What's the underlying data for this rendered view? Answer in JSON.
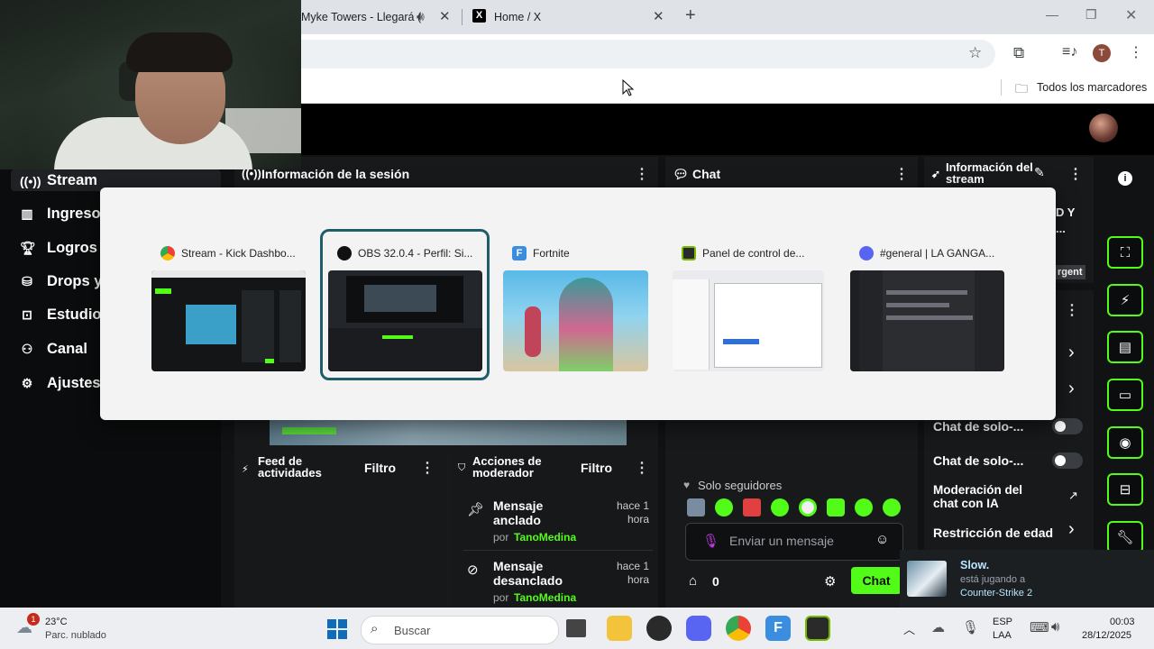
{
  "browser": {
    "tabs": [
      {
        "label": "Myke Towers - Llegará (",
        "audio_icon": "speaker-icon"
      },
      {
        "label": "Home / X"
      }
    ],
    "bookmarks_label": "Todos los marcadores",
    "profile_initial": "T"
  },
  "sidebar": {
    "items": [
      {
        "label": "Stream",
        "icon": "broadcast-icon"
      },
      {
        "label": "Ingresos",
        "icon": "chart-icon"
      },
      {
        "label": "Logros",
        "icon": "trophy-icon"
      },
      {
        "label": "Drops y",
        "icon": "drops-icon"
      },
      {
        "label": "Estudio",
        "icon": "studio-icon"
      },
      {
        "label": "Canal",
        "icon": "channel-icon"
      },
      {
        "label": "Ajustes",
        "icon": "gear-icon"
      }
    ]
  },
  "panels": {
    "session_info": "Información de la sesión",
    "chat": "Chat",
    "stream_info": "Información del stream",
    "stream_info_partial": [
      "D Y",
      "..."
    ],
    "urgent_partial": "rgent",
    "activity_feed": "Feed de actividades",
    "filter": "Filtro",
    "mod_actions": "Acciones de moderador"
  },
  "mod_log": [
    {
      "action": "Mensaje anclado",
      "time": "hace 1 hora",
      "by": "por",
      "user": "TanoMedina"
    },
    {
      "action": "Mensaje desanclado",
      "time": "hace 1 hora",
      "by": "por",
      "user": "TanoMedina"
    }
  ],
  "chat_box": {
    "followers_only": "Solo seguidores",
    "placeholder": "Enviar un mensaje",
    "count": "0",
    "send_label": "Chat"
  },
  "settings": {
    "solo1": "Chat de solo-...",
    "solo2": "Chat de solo-...",
    "ai_mod": "Moderación del chat con IA",
    "age": "Restricción de edad"
  },
  "switcher": {
    "windows": [
      {
        "title": "Stream - Kick Dashbo...",
        "icon": "chrome-icon"
      },
      {
        "title": "OBS 32.0.4 - Perfil: Si...",
        "icon": "obs-icon",
        "selected": true
      },
      {
        "title": "Fortnite",
        "icon": "fortnite-icon"
      },
      {
        "title": "Panel de control de...",
        "icon": "nvidia-icon"
      },
      {
        "title": "#general | LA GANGA...",
        "icon": "discord-icon"
      }
    ]
  },
  "notification": {
    "name": "Slow.",
    "status": "está jugando a",
    "game": "Counter-Strike 2"
  },
  "taskbar": {
    "weather_badge": "1",
    "temp": "23°C",
    "condition": "Parc. nublado",
    "search": "Buscar",
    "lang1": "ESP",
    "lang2": "LAA",
    "time": "00:03",
    "date": "28/12/2025"
  },
  "colors": {
    "kick_green": "#53fc18",
    "switcher_selected": "#1f5d6a",
    "panel_bg": "#17191b"
  }
}
